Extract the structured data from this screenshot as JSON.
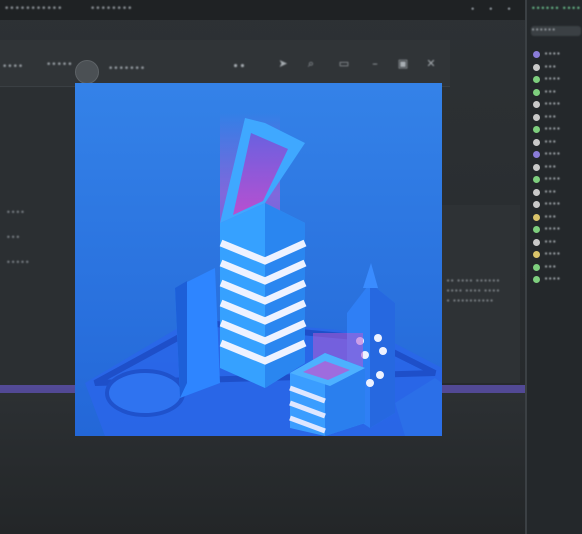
{
  "window": {
    "tabs": [
      {
        "label": "•••••••••••"
      },
      {
        "label": "••••••••"
      }
    ],
    "menu_dots": "• • •"
  },
  "toolbar": {
    "left_label": "••••",
    "mid_label": "•••••",
    "view_label": "•••••••",
    "icons": [
      "grid-icon",
      "cursor-icon",
      "zoom-icon",
      "fit-icon",
      "minimize-icon",
      "maximize-icon",
      "close-icon"
    ]
  },
  "left_panel": {
    "items": [
      "••••",
      "•••",
      "•••••"
    ]
  },
  "right_panel": {
    "lines": [
      "•• •••• ••••••",
      "•••• •••• ••••",
      "• ••••••••••"
    ]
  },
  "outliner": {
    "header": "•••••• ••••",
    "search": "••••••",
    "rows": [
      {
        "label": "••••",
        "color": "#8a7cd8"
      },
      {
        "label": "•••",
        "color": "#c9c9c9"
      },
      {
        "label": "••••",
        "color": "#7ecf7e"
      },
      {
        "label": "•••",
        "color": "#7ecf7e"
      },
      {
        "label": "••••",
        "color": "#c9c9c9"
      },
      {
        "label": "•••",
        "color": "#c9c9c9"
      },
      {
        "label": "••••",
        "color": "#7ecf7e"
      },
      {
        "label": "•••",
        "color": "#c9c9c9"
      },
      {
        "label": "••••",
        "color": "#8a7cd8"
      },
      {
        "label": "•••",
        "color": "#c9c9c9"
      },
      {
        "label": "••••",
        "color": "#7ecf7e"
      },
      {
        "label": "•••",
        "color": "#c9c9c9"
      },
      {
        "label": "••••",
        "color": "#c9c9c9"
      },
      {
        "label": "•••",
        "color": "#d9c36a"
      },
      {
        "label": "••••",
        "color": "#7ecf7e"
      },
      {
        "label": "•••",
        "color": "#c9c9c9"
      },
      {
        "label": "••••",
        "color": "#d9c36a"
      },
      {
        "label": "•••",
        "color": "#7ecf7e"
      },
      {
        "label": "••••",
        "color": "#7ecf7e"
      }
    ]
  },
  "image_preview": {
    "subject": "isometric-city-icon",
    "colors": {
      "bg": "#2f7ee6",
      "accent": "#b35bd6",
      "building": "#2f8cff",
      "stripe": "#e8ecff"
    }
  }
}
